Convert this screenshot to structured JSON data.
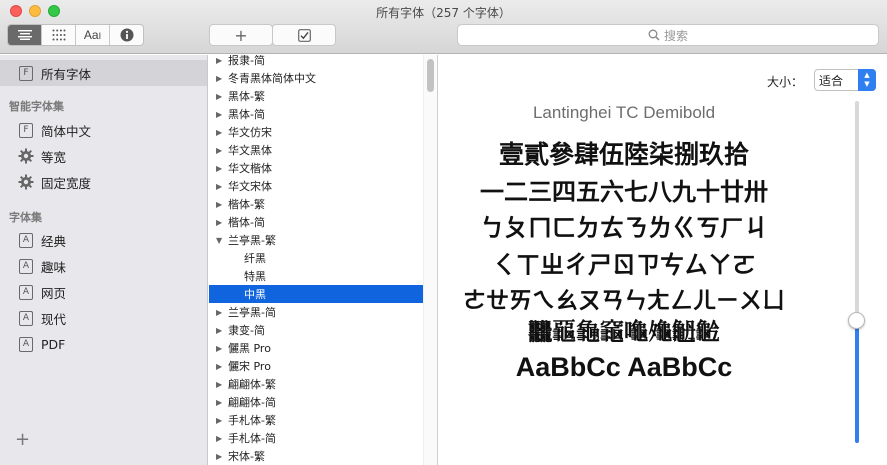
{
  "window": {
    "title": "所有字体（257 个字体）"
  },
  "toolbar": {
    "add_label": "+",
    "search_placeholder": "搜索"
  },
  "sidebar": {
    "all_fonts": "所有字体",
    "smart_header": "智能字体集",
    "smart_items": [
      {
        "label": "简体中文",
        "icon": "font-box-icon"
      },
      {
        "label": "等宽",
        "icon": "gear-icon"
      },
      {
        "label": "固定宽度",
        "icon": "gear-icon"
      }
    ],
    "collections_header": "字体集",
    "collections": [
      {
        "label": "经典"
      },
      {
        "label": "趣味"
      },
      {
        "label": "网页"
      },
      {
        "label": "现代"
      },
      {
        "label": "PDF"
      }
    ],
    "add_label": "+"
  },
  "fontlist": {
    "items": [
      {
        "label": "报隶-简",
        "type": "collapsed"
      },
      {
        "label": "冬青黑体简体中文",
        "type": "collapsed"
      },
      {
        "label": "黑体-繁",
        "type": "collapsed"
      },
      {
        "label": "黑体-简",
        "type": "collapsed"
      },
      {
        "label": "华文仿宋",
        "type": "collapsed"
      },
      {
        "label": "华文黑体",
        "type": "collapsed"
      },
      {
        "label": "华文楷体",
        "type": "collapsed"
      },
      {
        "label": "华文宋体",
        "type": "collapsed"
      },
      {
        "label": "楷体-繁",
        "type": "collapsed"
      },
      {
        "label": "楷体-简",
        "type": "collapsed"
      },
      {
        "label": "兰亭黑-繁",
        "type": "expanded"
      },
      {
        "label": "纤黑",
        "type": "child"
      },
      {
        "label": "特黑",
        "type": "child"
      },
      {
        "label": "中黑",
        "type": "child-selected"
      },
      {
        "label": "兰亭黑-简",
        "type": "collapsed"
      },
      {
        "label": "隶变-简",
        "type": "collapsed"
      },
      {
        "label": "儷黑 Pro",
        "type": "collapsed"
      },
      {
        "label": "儷宋 Pro",
        "type": "collapsed"
      },
      {
        "label": "翩翩体-繁",
        "type": "collapsed"
      },
      {
        "label": "翩翩体-简",
        "type": "collapsed"
      },
      {
        "label": "手札体-繁",
        "type": "collapsed"
      },
      {
        "label": "手札体-简",
        "type": "collapsed"
      },
      {
        "label": "宋体-繁",
        "type": "collapsed"
      }
    ]
  },
  "preview": {
    "size_label": "大小：",
    "size_value": "适合",
    "font_name": "Lantinghei TC Demibold",
    "samples": [
      "壹貳參肆伍陸柒捌玖拾",
      "一二三四五六七八九十廿卅",
      "ㄅㄆㄇㄈㄉㄊㄋㄌㄍㄎㄏㄐ",
      "ㄑㄒㄓㄔㄕㄖㄗㄘㄙㄚㄛ",
      "ㄜㄝㄞㄟㄠㄡㄢㄣㄤㄥㄦㄧㄨㄩ",
      "𪚥𪚦𪚧𪚨𪚩𪚪𪚫𪚬",
      "AaBbCc AaBbCc"
    ],
    "slider_level": 0.36
  }
}
